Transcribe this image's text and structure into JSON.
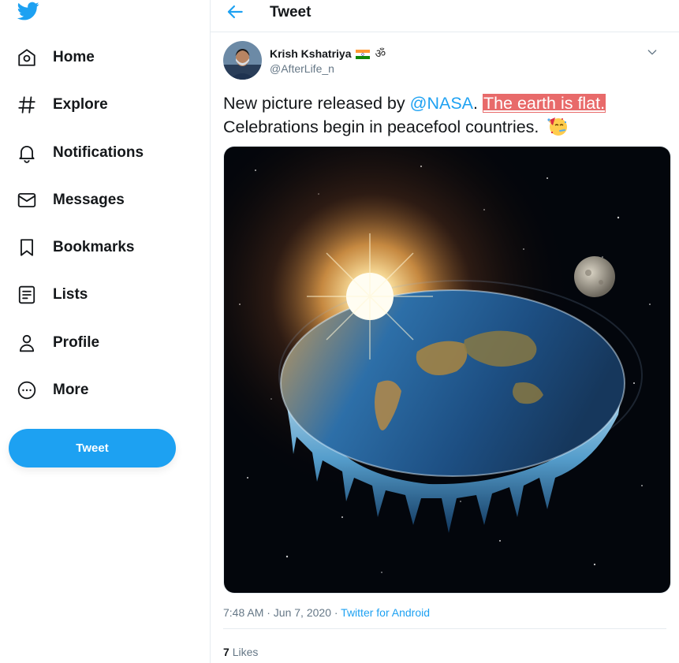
{
  "sidebar": {
    "logo": "twitter-bird-icon",
    "items": [
      {
        "label": "Home",
        "icon": "home-icon"
      },
      {
        "label": "Explore",
        "icon": "hashtag-icon"
      },
      {
        "label": "Notifications",
        "icon": "bell-icon"
      },
      {
        "label": "Messages",
        "icon": "envelope-icon"
      },
      {
        "label": "Bookmarks",
        "icon": "bookmark-icon"
      },
      {
        "label": "Lists",
        "icon": "list-icon"
      },
      {
        "label": "Profile",
        "icon": "person-icon"
      },
      {
        "label": "More",
        "icon": "more-circle-icon"
      }
    ],
    "tweet_button": "Tweet"
  },
  "header": {
    "title": "Tweet"
  },
  "tweet": {
    "author_name": "Krish Kshatriya",
    "om_symbol": "ॐ",
    "handle": "@AfterLife_n",
    "text_before": "New picture released by ",
    "mention": "@NASA",
    "text_mid": ". ",
    "highlighted": "The earth is flat.",
    "text_after": "Celebrations begin in peacefool countries.",
    "time": "7:48 AM · Jun 7, 2020 · ",
    "source": "Twitter for Android",
    "likes_count": "7",
    "likes_label": "Likes"
  },
  "colors": {
    "accent": "#1da1f2",
    "highlight": "#e86a6a",
    "muted": "#657786"
  }
}
